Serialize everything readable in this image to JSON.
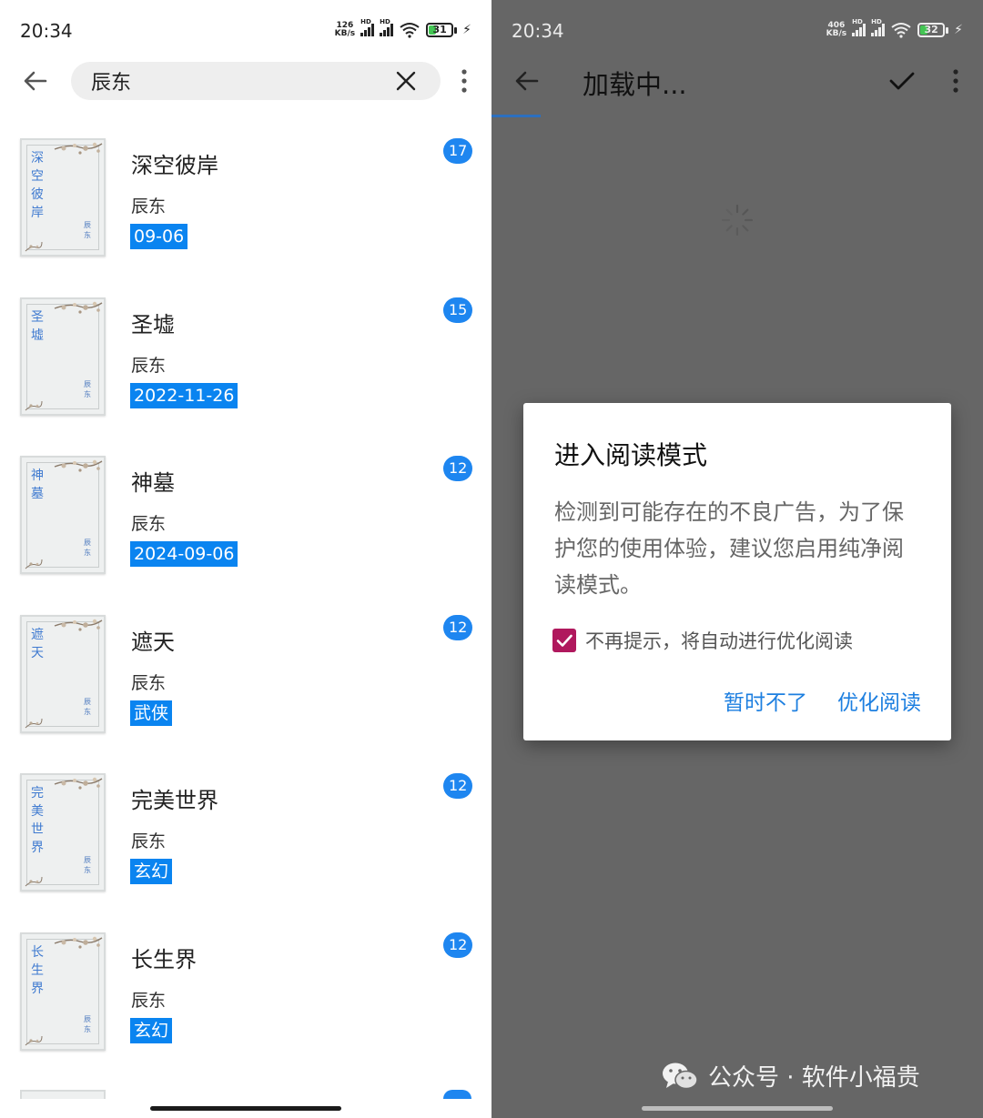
{
  "status_bar": {
    "left": {
      "time": "20:34",
      "netspeed_value": "126",
      "netspeed_unit": "KB/s",
      "battery": "31"
    },
    "right": {
      "time": "20:34",
      "netspeed_value": "406",
      "netspeed_unit": "KB/s",
      "battery": "32"
    },
    "hd_label": "HD"
  },
  "search": {
    "query": "辰东"
  },
  "results": [
    {
      "title": "深空彼岸",
      "cover_title": "深空彼岸",
      "author": "辰东",
      "cover_author": "辰东",
      "tag": "09-06",
      "count": "17"
    },
    {
      "title": "圣墟",
      "cover_title": "圣墟",
      "author": "辰东",
      "cover_author": "辰东",
      "tag": "2022-11-26",
      "count": "15"
    },
    {
      "title": "神墓",
      "cover_title": "神墓",
      "author": "辰东",
      "cover_author": "辰东",
      "tag": "2024-09-06",
      "count": "12"
    },
    {
      "title": "遮天",
      "cover_title": "遮天",
      "author": "辰东",
      "cover_author": "辰东",
      "tag": "武侠",
      "count": "12"
    },
    {
      "title": "完美世界",
      "cover_title": "完美世界",
      "author": "辰东",
      "cover_author": "辰东",
      "tag": "玄幻",
      "count": "12"
    },
    {
      "title": "长生界",
      "cover_title": "长生界",
      "author": "辰东",
      "cover_author": "辰东",
      "tag": "玄幻",
      "count": "12"
    }
  ],
  "reader": {
    "title": "加载中..."
  },
  "dialog": {
    "title": "进入阅读模式",
    "message": "检测到可能存在的不良广告，为了保护您的使用体验，建议您启用纯净阅读模式。",
    "checkbox_label": "不再提示，将自动进行优化阅读",
    "checkbox_checked": true,
    "cancel_label": "暂时不了",
    "confirm_label": "优化阅读"
  },
  "watermark": {
    "text": "公众号 · 软件小福贵"
  },
  "colors": {
    "accent_blue": "#1e86f0",
    "tag_blue": "#0a84f0",
    "checkbox": "#b0185d",
    "overlay_gray": "#666666"
  }
}
